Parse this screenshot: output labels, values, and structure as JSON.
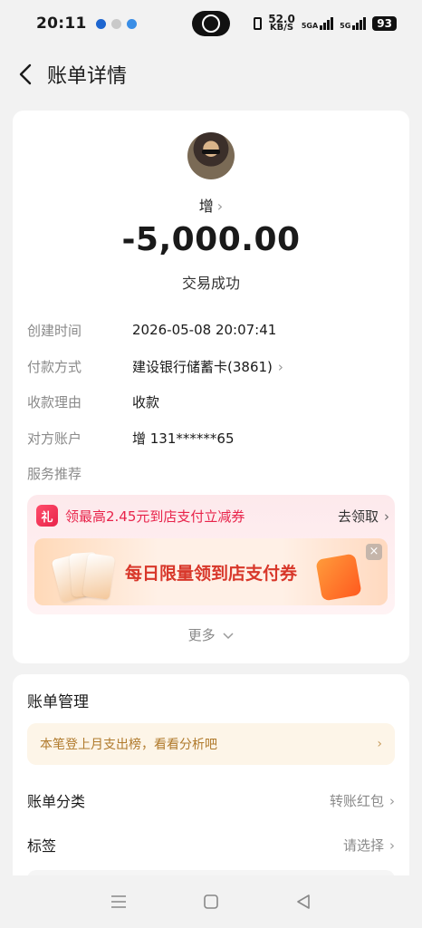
{
  "status_bar": {
    "time": "20:11",
    "speed_value": "52.0",
    "speed_unit": "KB/S",
    "net_5ga": "5GA",
    "net_5g": "5G",
    "battery": "93"
  },
  "header": {
    "title": "账单详情"
  },
  "transaction": {
    "payee": "增",
    "amount": "-5,000.00",
    "status": "交易成功"
  },
  "details": [
    {
      "label": "创建时间",
      "value": "2026-05-08 20:07:41",
      "has_arrow": false
    },
    {
      "label": "付款方式",
      "value": "建设银行储蓄卡(3861)",
      "has_arrow": true
    },
    {
      "label": "收款理由",
      "value": "收款",
      "has_arrow": false
    },
    {
      "label": "对方账户",
      "value": "增 131******65",
      "has_arrow": false
    },
    {
      "label": "服务推荐",
      "value": "",
      "has_arrow": false
    }
  ],
  "promo": {
    "gift_label": "礼",
    "text": "领最高2.45元到店支付立减券",
    "action": "去领取",
    "banner_title": "每日限量领到店支付券",
    "close": "×"
  },
  "more": {
    "label": "更多"
  },
  "management": {
    "title": "账单管理",
    "notice": "本笔登上月支出榜，看看分析吧",
    "rows": [
      {
        "label": "账单分类",
        "value": "转账红包"
      },
      {
        "label": "标签",
        "value": "请选择"
      }
    ]
  },
  "colors": {
    "accent_red": "#e8234a",
    "page_bg": "#f2f2f2",
    "notice_text": "#b07a2c"
  }
}
